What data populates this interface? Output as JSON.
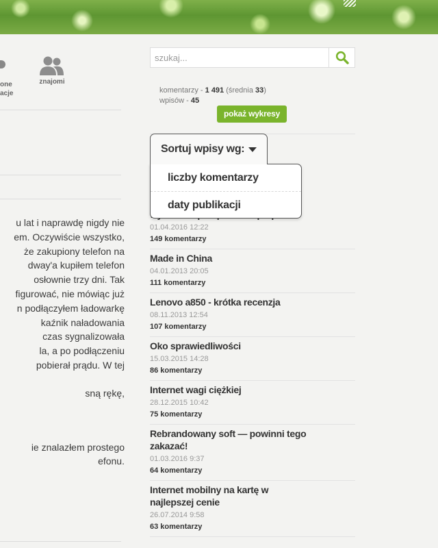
{
  "banner": {
    "name": "header-banner"
  },
  "nav": {
    "partial_item": {
      "line1": "one",
      "line2": "acje"
    },
    "friends": {
      "label": "znajomi"
    }
  },
  "article_lines": [
    "u lat i naprawdę nigdy nie",
    "em. Oczywiście wszystko,",
    "że zakupiony telefon na",
    "dway'a kupiłem telefon",
    "osłownie trzy dni. Tak",
    "figurować, nie mówiąc już",
    "n podłączyłem ładowarkę",
    "kaźnik naładowania",
    "czas sygnalizowała",
    "la, a po podłączeniu",
    "pobierał prądu. W tej",
    "sną rękę,",
    "ie znalazłem prostego",
    "efonu."
  ],
  "search": {
    "placeholder": "szukaj..."
  },
  "stats": {
    "comments_label": "komentarzy",
    "comments_value": "1 491",
    "avg_label": "średnia",
    "avg_value": "33",
    "posts_label": "wpisów",
    "posts_value": "45",
    "chart_button": "pokaż wykresy"
  },
  "sort": {
    "label": "Sortuj wpisy wg:",
    "options": [
      "liczby komentarzy",
      "daty publikacji"
    ]
  },
  "posts": [
    {
      "title": "wyższości postpaid nad prepaid",
      "date": "01.04.2016 12:22",
      "count": "149 komentarzy"
    },
    {
      "title": "Made in China",
      "date": "04.01.2013 20:05",
      "count": "111 komentarzy"
    },
    {
      "title": "Lenovo a850 - krótka recenzja",
      "date": "08.11.2013 12:54",
      "count": "107 komentarzy"
    },
    {
      "title": "Oko sprawiedliwości",
      "date": "15.03.2015 14:28",
      "count": "86 komentarzy"
    },
    {
      "title": "Internet wagi ciężkiej",
      "date": "28.12.2015 10:42",
      "count": "75 komentarzy"
    },
    {
      "title": "Rebrandowany soft — powinni tego zakazać!",
      "date": "01.03.2016 9:37",
      "count": "64 komentarzy"
    },
    {
      "title": "Internet mobilny na kartę w najlepszej cenie",
      "date": "26.07.2014 9:58",
      "count": "63 komentarzy"
    }
  ],
  "colors": {
    "accent": "#7ab42c",
    "background": "#f3f3f1"
  }
}
